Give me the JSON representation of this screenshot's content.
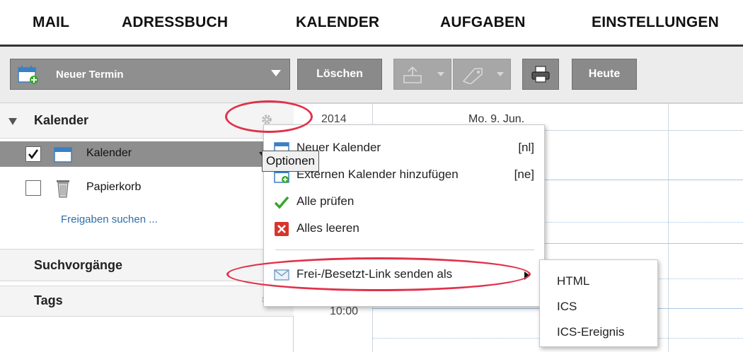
{
  "topnav": {
    "tabs": [
      "MAIL",
      "ADRESSBUCH",
      "KALENDER",
      "AUFGABEN",
      "EINSTELLUNGEN"
    ]
  },
  "toolbar": {
    "new_event": "Neuer Termin",
    "delete": "Löschen",
    "today": "Heute"
  },
  "sidebar": {
    "calendar_section": "Kalender",
    "calendars": [
      {
        "label": "Kalender",
        "checked": true
      },
      {
        "label": "Papierkorb",
        "checked": false
      }
    ],
    "find_shares": "Freigaben suchen ...",
    "searches_section": "Suchvorgänge",
    "tags_section": "Tags"
  },
  "calendar": {
    "year": "2014",
    "day_header": "Mo. 9. Jun.",
    "time_label": "10:00"
  },
  "tooltip": "Optionen",
  "context_menu": {
    "items": [
      {
        "label": "Neuer Kalender",
        "shortcut": "[nl]",
        "icon": "new-calendar-icon"
      },
      {
        "label": "Externen Kalender hinzufügen",
        "shortcut": "[ne]",
        "icon": "external-calendar-icon"
      },
      {
        "label": "Alle prüfen",
        "icon": "checkmark-icon"
      },
      {
        "label": "Alles leeren",
        "icon": "clear-icon"
      },
      {
        "label": "Frei-/Besetzt-Link senden als",
        "icon": "envelope-icon"
      }
    ],
    "submenu": [
      "HTML",
      "ICS",
      "ICS-Ereignis"
    ]
  },
  "colors": {
    "highlight": "#e0324a",
    "toolbar_button": "#8a8a8a",
    "selected_row": "#8e8e8e",
    "check_green": "#3aa52e",
    "clear_red": "#d9342b"
  }
}
